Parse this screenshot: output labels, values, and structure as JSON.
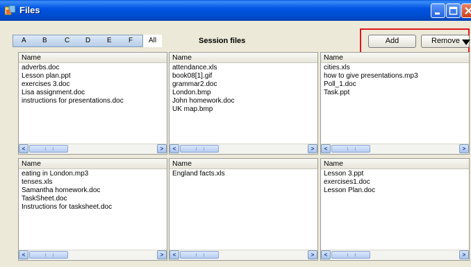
{
  "window": {
    "title": "Files",
    "icon": "files-app-icon"
  },
  "letter_tabs": [
    "A",
    "B",
    "C",
    "D",
    "E",
    "F"
  ],
  "letter_all": "All",
  "session_title": "Session files",
  "buttons": {
    "add": "Add",
    "remove": "Remove"
  },
  "column_header": "Name",
  "panels": [
    {
      "files": [
        "adverbs.doc",
        "Lesson plan.ppt",
        "exercises 3.doc",
        "Lisa assignment.doc",
        "instructions for presentations.doc"
      ]
    },
    {
      "files": [
        "attendance.xls",
        "book08[1].gif",
        "grammar2.doc",
        "London.bmp",
        "John homework.doc",
        "UK map.bmp"
      ]
    },
    {
      "files": [
        "cities.xls",
        "how to give presentations.mp3",
        "Poll_1.doc",
        "Task.ppt"
      ]
    },
    {
      "files": [
        "eating in London.mp3",
        "tenses.xls",
        "Samantha homework.doc",
        "TaskSheet.doc",
        "Instructions for tasksheet.doc"
      ]
    },
    {
      "files": [
        "England facts.xls"
      ]
    },
    {
      "files": [
        "Lesson 3.ppt",
        "exercises1.doc",
        "Lesson Plan.doc"
      ]
    }
  ],
  "colors": {
    "titlebar": "#0054e3",
    "highlight": "#e0151b",
    "window_bg": "#ece9d8"
  }
}
